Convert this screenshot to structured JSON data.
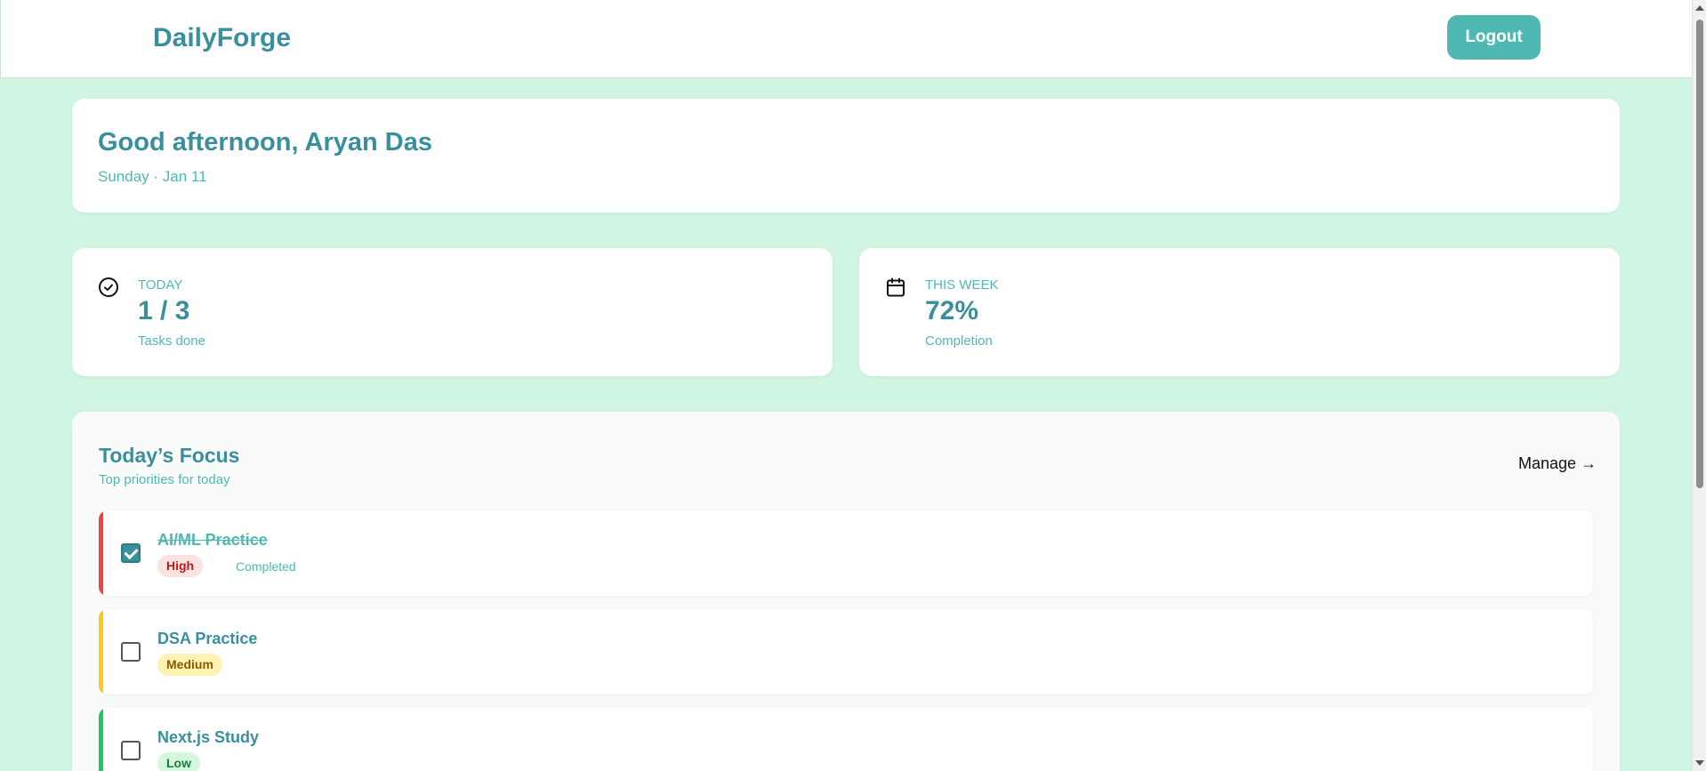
{
  "header": {
    "brand": "DailyForge",
    "logout_label": "Logout"
  },
  "greeting": {
    "title": "Good afternoon, Aryan Das",
    "date": "Sunday · Jan 11"
  },
  "stats": {
    "today": {
      "icon": "check-circle-icon",
      "label": "TODAY",
      "value": "1 / 3",
      "sub": "Tasks done"
    },
    "week": {
      "icon": "calendar-icon",
      "label": "THIS WEEK",
      "value": "72%",
      "sub": "Completion"
    }
  },
  "focus": {
    "title": "Today’s Focus",
    "subtitle": "Top priorities for today",
    "manage_label": "Manage →",
    "tasks": [
      {
        "name": "AI/ML Practice",
        "priority": "High",
        "priority_color": "#ef4444",
        "checked": true,
        "status": "Completed"
      },
      {
        "name": "DSA Practice",
        "priority": "Medium",
        "priority_color": "#facc15",
        "checked": false,
        "status": ""
      },
      {
        "name": "Next.js Study",
        "priority": "Low",
        "priority_color": "#22c55e",
        "checked": false,
        "status": ""
      }
    ]
  },
  "colors": {
    "background": "#d1f5e3",
    "accent": "#4fb8b2",
    "heading": "#3a8f9c"
  }
}
